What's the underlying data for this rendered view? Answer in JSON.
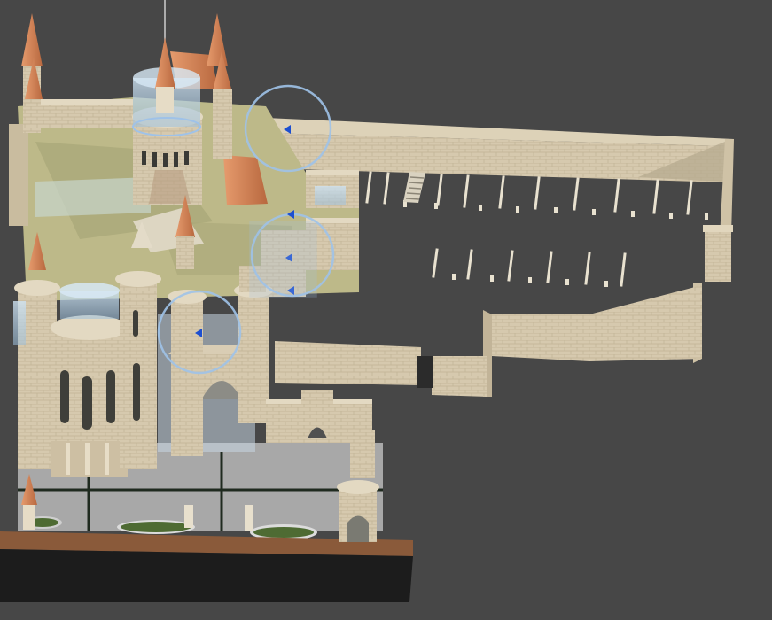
{
  "viewport": {
    "background": "#474747",
    "scene_type": "3D castle model viewport",
    "selection_gizmo_color": "#9fc2e8",
    "handle_color": "#1d4fd0"
  },
  "palette": {
    "stone_light": "#d9cdb4",
    "stone_mid": "#c7b99d",
    "stone_shadow": "#a3977f",
    "roof_terracotta": "#d98a5e",
    "courtyard_olive": "#bdb989",
    "glass_blue": "#b8d4ea",
    "plaza_grey": "#a9a9a9",
    "hedge_green": "#4e6b33",
    "road_dark": "#1c1c1c",
    "dirt_brown": "#8a5a3a"
  }
}
